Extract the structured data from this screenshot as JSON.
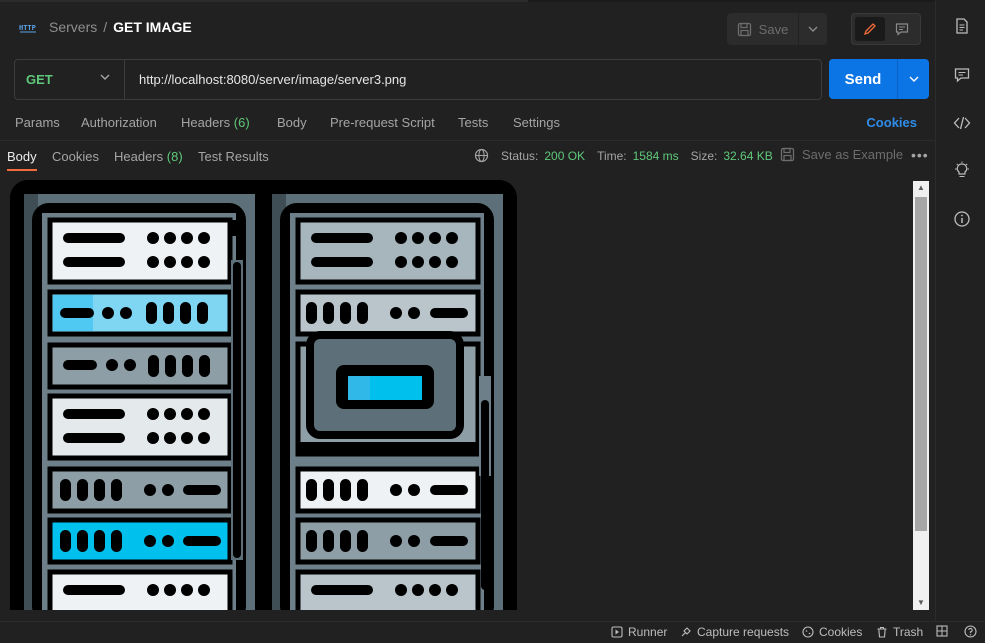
{
  "header": {
    "breadcrumb_parent": "Servers",
    "breadcrumb_separator": "/",
    "breadcrumb_current": "GET IMAGE",
    "save_label": "Save",
    "http_icon_text": "HTTP"
  },
  "request": {
    "method": "GET",
    "url": "http://localhost:8080/server/image/server3.png",
    "send_label": "Send"
  },
  "request_tabs": {
    "params": "Params",
    "authorization": "Authorization",
    "headers": "Headers",
    "headers_count": "(6)",
    "body": "Body",
    "pre_request": "Pre-request Script",
    "tests": "Tests",
    "settings": "Settings",
    "cookies": "Cookies"
  },
  "response_tabs": {
    "body": "Body",
    "cookies": "Cookies",
    "headers": "Headers",
    "headers_count": "(8)",
    "test_results": "Test Results"
  },
  "response_meta": {
    "status_label": "Status:",
    "status_value": "200 OK",
    "time_label": "Time:",
    "time_value": "1584 ms",
    "size_label": "Size:",
    "size_value": "32.64 KB",
    "save_example": "Save as Example",
    "more": "•••"
  },
  "footer": {
    "runner": "Runner",
    "capture": "Capture requests",
    "cookies": "Cookies",
    "trash": "Trash"
  },
  "colors": {
    "accent_send": "#0c75e6",
    "success_green": "#5fc87a",
    "active_tab_underline": "#f26b3a",
    "link_blue": "#2f8dea"
  }
}
